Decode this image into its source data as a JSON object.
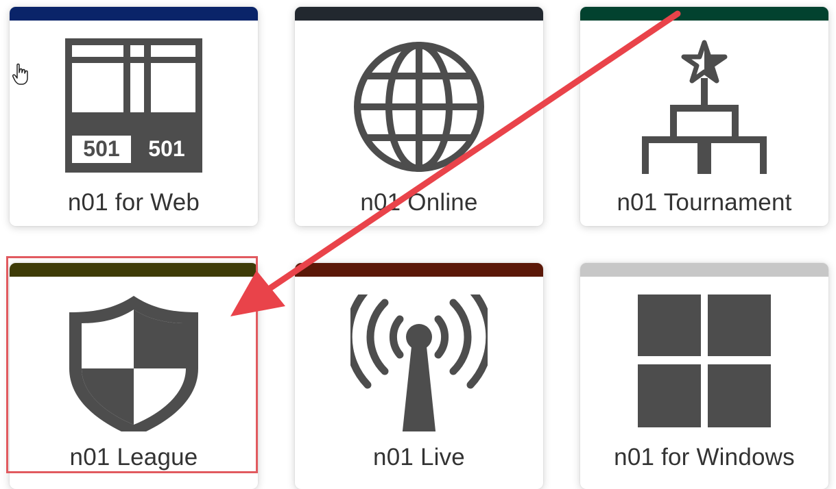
{
  "apps": [
    {
      "label": "n01 for Web",
      "accent": "#0a2469",
      "icon": "scoreboard-501-icon",
      "score_left": "501",
      "score_right": "501"
    },
    {
      "label": "n01 Online",
      "accent": "#22282f",
      "icon": "globe-icon"
    },
    {
      "label": "n01 Tournament",
      "accent": "#02422f",
      "icon": "tournament-bracket-icon"
    },
    {
      "label": "n01 League",
      "accent": "#3e3b07",
      "icon": "shield-icon",
      "highlighted": true
    },
    {
      "label": "n01 Live",
      "accent": "#5b1808",
      "icon": "antenna-broadcast-icon"
    },
    {
      "label": "n01 for Windows",
      "accent": "#c7c7c7",
      "icon": "windows-logo-icon"
    }
  ],
  "annotation": {
    "arrow_color": "#e9434a",
    "highlight_color": "#e15a5f"
  },
  "icon_color": "#4d4d4d"
}
